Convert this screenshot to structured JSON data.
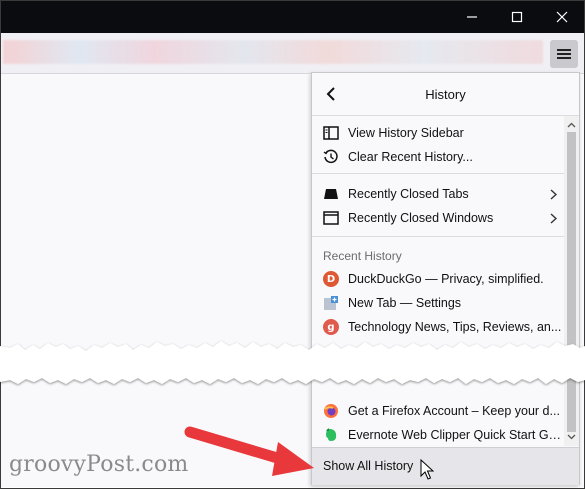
{
  "window": {
    "minimize_icon": "minimize-icon",
    "maximize_icon": "maximize-icon",
    "close_icon": "close-icon"
  },
  "toolbar": {
    "menu_icon": "hamburger-menu-icon"
  },
  "panel": {
    "title": "History",
    "back_icon": "back-arrow-icon",
    "actions": [
      {
        "label": "View History Sidebar",
        "icon": "sidebar-icon"
      },
      {
        "label": "Clear Recent History...",
        "icon": "history-clock-icon"
      }
    ],
    "submenus": [
      {
        "label": "Recently Closed Tabs",
        "icon": "closed-tab-icon"
      },
      {
        "label": "Recently Closed Windows",
        "icon": "closed-window-icon"
      }
    ],
    "recent_label": "Recent History",
    "recent_items": [
      {
        "label": "DuckDuckGo — Privacy, simplified.",
        "icon": "duckduckgo-icon",
        "color": "#de5833"
      },
      {
        "label": "New Tab — Settings",
        "icon": "new-tab-settings-icon",
        "color": "#4a90d9"
      },
      {
        "label": "Technology News, Tips, Reviews, an...",
        "icon": "groovypost-icon",
        "color": "#e05a4e"
      }
    ],
    "recent_items_after_tear": [
      {
        "label": "Get a Firefox Account – Keep your d...",
        "icon": "firefox-icon",
        "color": "#ff7139"
      },
      {
        "label": "Evernote Web Clipper Quick Start Gu...",
        "icon": "evernote-icon",
        "color": "#2dbe60"
      }
    ],
    "footer_label": "Show All History"
  },
  "watermark": "groovyPost.com",
  "colors": {
    "titlebar": "#0b0c0f",
    "annotation_arrow": "#e8383b",
    "panel_bg": "#f9f9fb",
    "footer_bg": "#e6e6ea"
  }
}
